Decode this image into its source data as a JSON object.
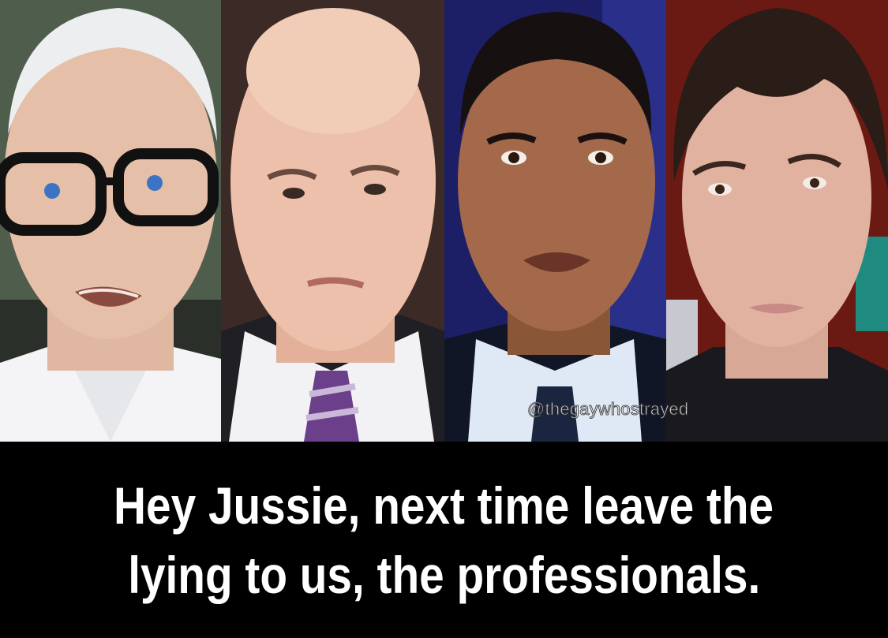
{
  "watermark": "@thegaywhostrayed",
  "caption": {
    "line1": "Hey Jussie, next time leave the",
    "line2": "lying to us, the professionals."
  },
  "colors": {
    "caption_background": "#000000",
    "caption_text": "#ffffff"
  }
}
